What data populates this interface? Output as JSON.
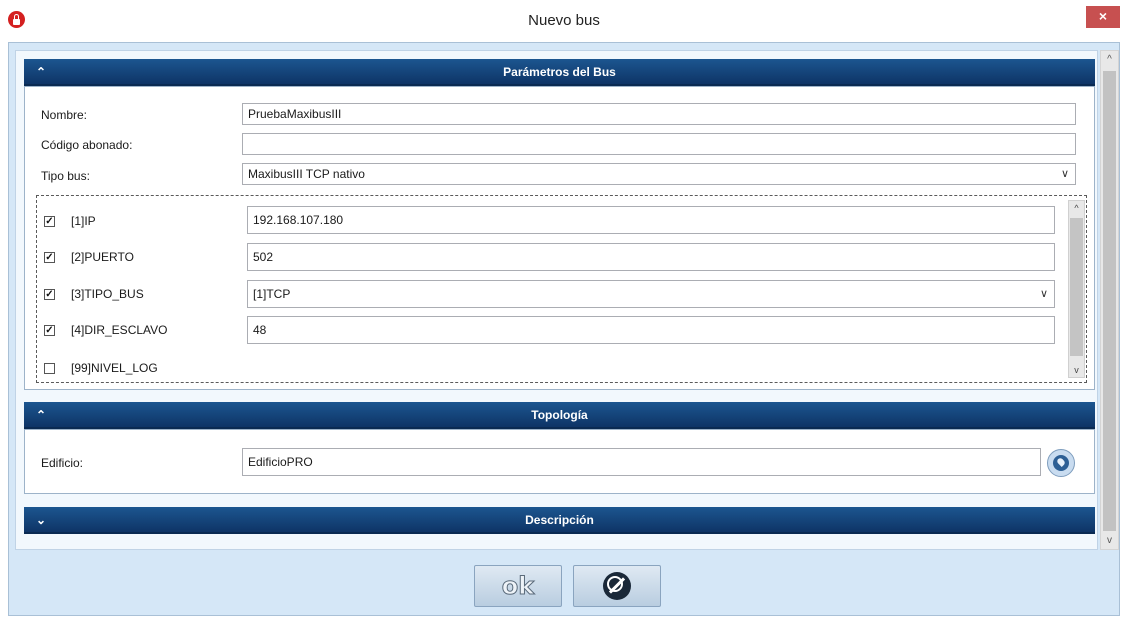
{
  "window": {
    "title": "Nuevo bus",
    "close_glyph": "×"
  },
  "sections": {
    "params": {
      "title": "Parámetros del Bus",
      "collapse_glyph": "⌃",
      "nombre": {
        "label": "Nombre:",
        "value": "PruebaMaxibusIII"
      },
      "codigo": {
        "label": "Código abonado:",
        "value": ""
      },
      "tipo": {
        "label": "Tipo bus:",
        "value": "MaxibusIII TCP nativo"
      },
      "rows": [
        {
          "label": "[1]IP",
          "value": "192.168.107.180",
          "checked": true
        },
        {
          "label": "[2]PUERTO",
          "value": "502",
          "checked": true
        },
        {
          "label": "[3]TIPO_BUS",
          "value": "[1]TCP",
          "checked": true
        },
        {
          "label": "[4]DIR_ESCLAVO",
          "value": "48",
          "checked": true
        },
        {
          "label": "[99]NIVEL_LOG",
          "value": "",
          "checked": false
        }
      ]
    },
    "topologia": {
      "title": "Topología",
      "edificio": {
        "label": "Edificio:",
        "value": "EdificioPRO"
      }
    },
    "descripcion": {
      "title": "Descripción"
    }
  },
  "buttons": {
    "ok_label": "ok"
  },
  "glyphs": {
    "check": "✓",
    "chevron_down": "⌄",
    "expand": "≫",
    "collapse": "≪",
    "scroll_up": "▲",
    "scroll_down": "▼"
  }
}
